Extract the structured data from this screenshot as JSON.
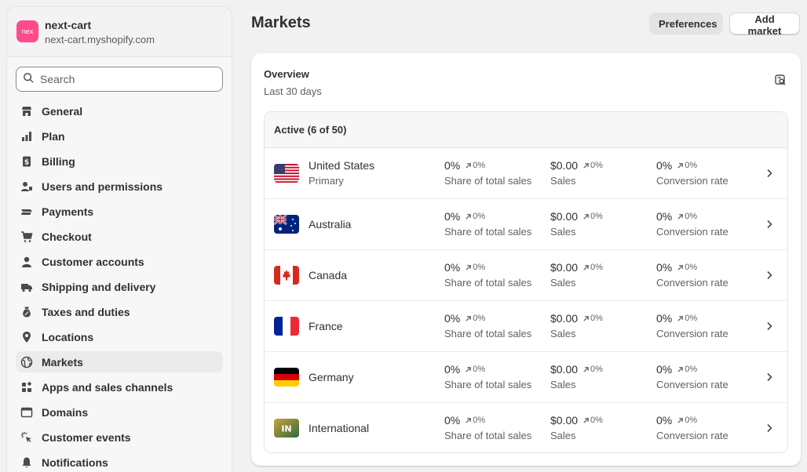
{
  "store": {
    "logo_text": "nex",
    "name": "next-cart",
    "domain": "next-cart.myshopify.com"
  },
  "search": {
    "placeholder": "Search"
  },
  "nav": [
    {
      "label": "General",
      "icon": "store-icon"
    },
    {
      "label": "Plan",
      "icon": "plan-icon"
    },
    {
      "label": "Billing",
      "icon": "billing-icon"
    },
    {
      "label": "Users and permissions",
      "icon": "users-icon"
    },
    {
      "label": "Payments",
      "icon": "payments-icon"
    },
    {
      "label": "Checkout",
      "icon": "cart-icon"
    },
    {
      "label": "Customer accounts",
      "icon": "person-icon"
    },
    {
      "label": "Shipping and delivery",
      "icon": "truck-icon"
    },
    {
      "label": "Taxes and duties",
      "icon": "tax-icon"
    },
    {
      "label": "Locations",
      "icon": "location-icon"
    },
    {
      "label": "Markets",
      "icon": "globe-icon",
      "active": true
    },
    {
      "label": "Apps and sales channels",
      "icon": "apps-icon"
    },
    {
      "label": "Domains",
      "icon": "domain-icon"
    },
    {
      "label": "Customer events",
      "icon": "cursor-icon"
    },
    {
      "label": "Notifications",
      "icon": "bell-icon"
    }
  ],
  "page": {
    "title": "Markets",
    "preferences_label": "Preferences",
    "add_label": "Add market"
  },
  "overview": {
    "title": "Overview",
    "subtitle": "Last 30 days",
    "icon": "report-icon"
  },
  "table": {
    "header": "Active (6 of 50)",
    "rows": [
      {
        "country": "United States",
        "sub": "Primary",
        "flag": "us-flag-icon",
        "share": "0%",
        "share_trend": "0%",
        "sales": "$0.00",
        "sales_trend": "0%",
        "conv": "0%",
        "conv_trend": "0%"
      },
      {
        "country": "Australia",
        "sub": "",
        "flag": "au-flag-icon",
        "share": "0%",
        "share_trend": "0%",
        "sales": "$0.00",
        "sales_trend": "0%",
        "conv": "0%",
        "conv_trend": "0%"
      },
      {
        "country": "Canada",
        "sub": "",
        "flag": "ca-flag-icon",
        "share": "0%",
        "share_trend": "0%",
        "sales": "$0.00",
        "sales_trend": "0%",
        "conv": "0%",
        "conv_trend": "0%"
      },
      {
        "country": "France",
        "sub": "",
        "flag": "fr-flag-icon",
        "share": "0%",
        "share_trend": "0%",
        "sales": "$0.00",
        "sales_trend": "0%",
        "conv": "0%",
        "conv_trend": "0%"
      },
      {
        "country": "Germany",
        "sub": "",
        "flag": "de-flag-icon",
        "share": "0%",
        "share_trend": "0%",
        "sales": "$0.00",
        "sales_trend": "0%",
        "conv": "0%",
        "conv_trend": "0%"
      },
      {
        "country": "International",
        "sub": "",
        "flag": "international-icon",
        "flag_text": "IN",
        "share": "0%",
        "share_trend": "0%",
        "sales": "$0.00",
        "sales_trend": "0%",
        "conv": "0%",
        "conv_trend": "0%"
      }
    ],
    "labels": {
      "share": "Share of total sales",
      "sales": "Sales",
      "conv": "Conversion rate"
    }
  },
  "colors": {
    "accent_logo": "#ff4a8b",
    "page_bg": "#f1f1f1",
    "text": "#303030",
    "muted": "#616161"
  }
}
